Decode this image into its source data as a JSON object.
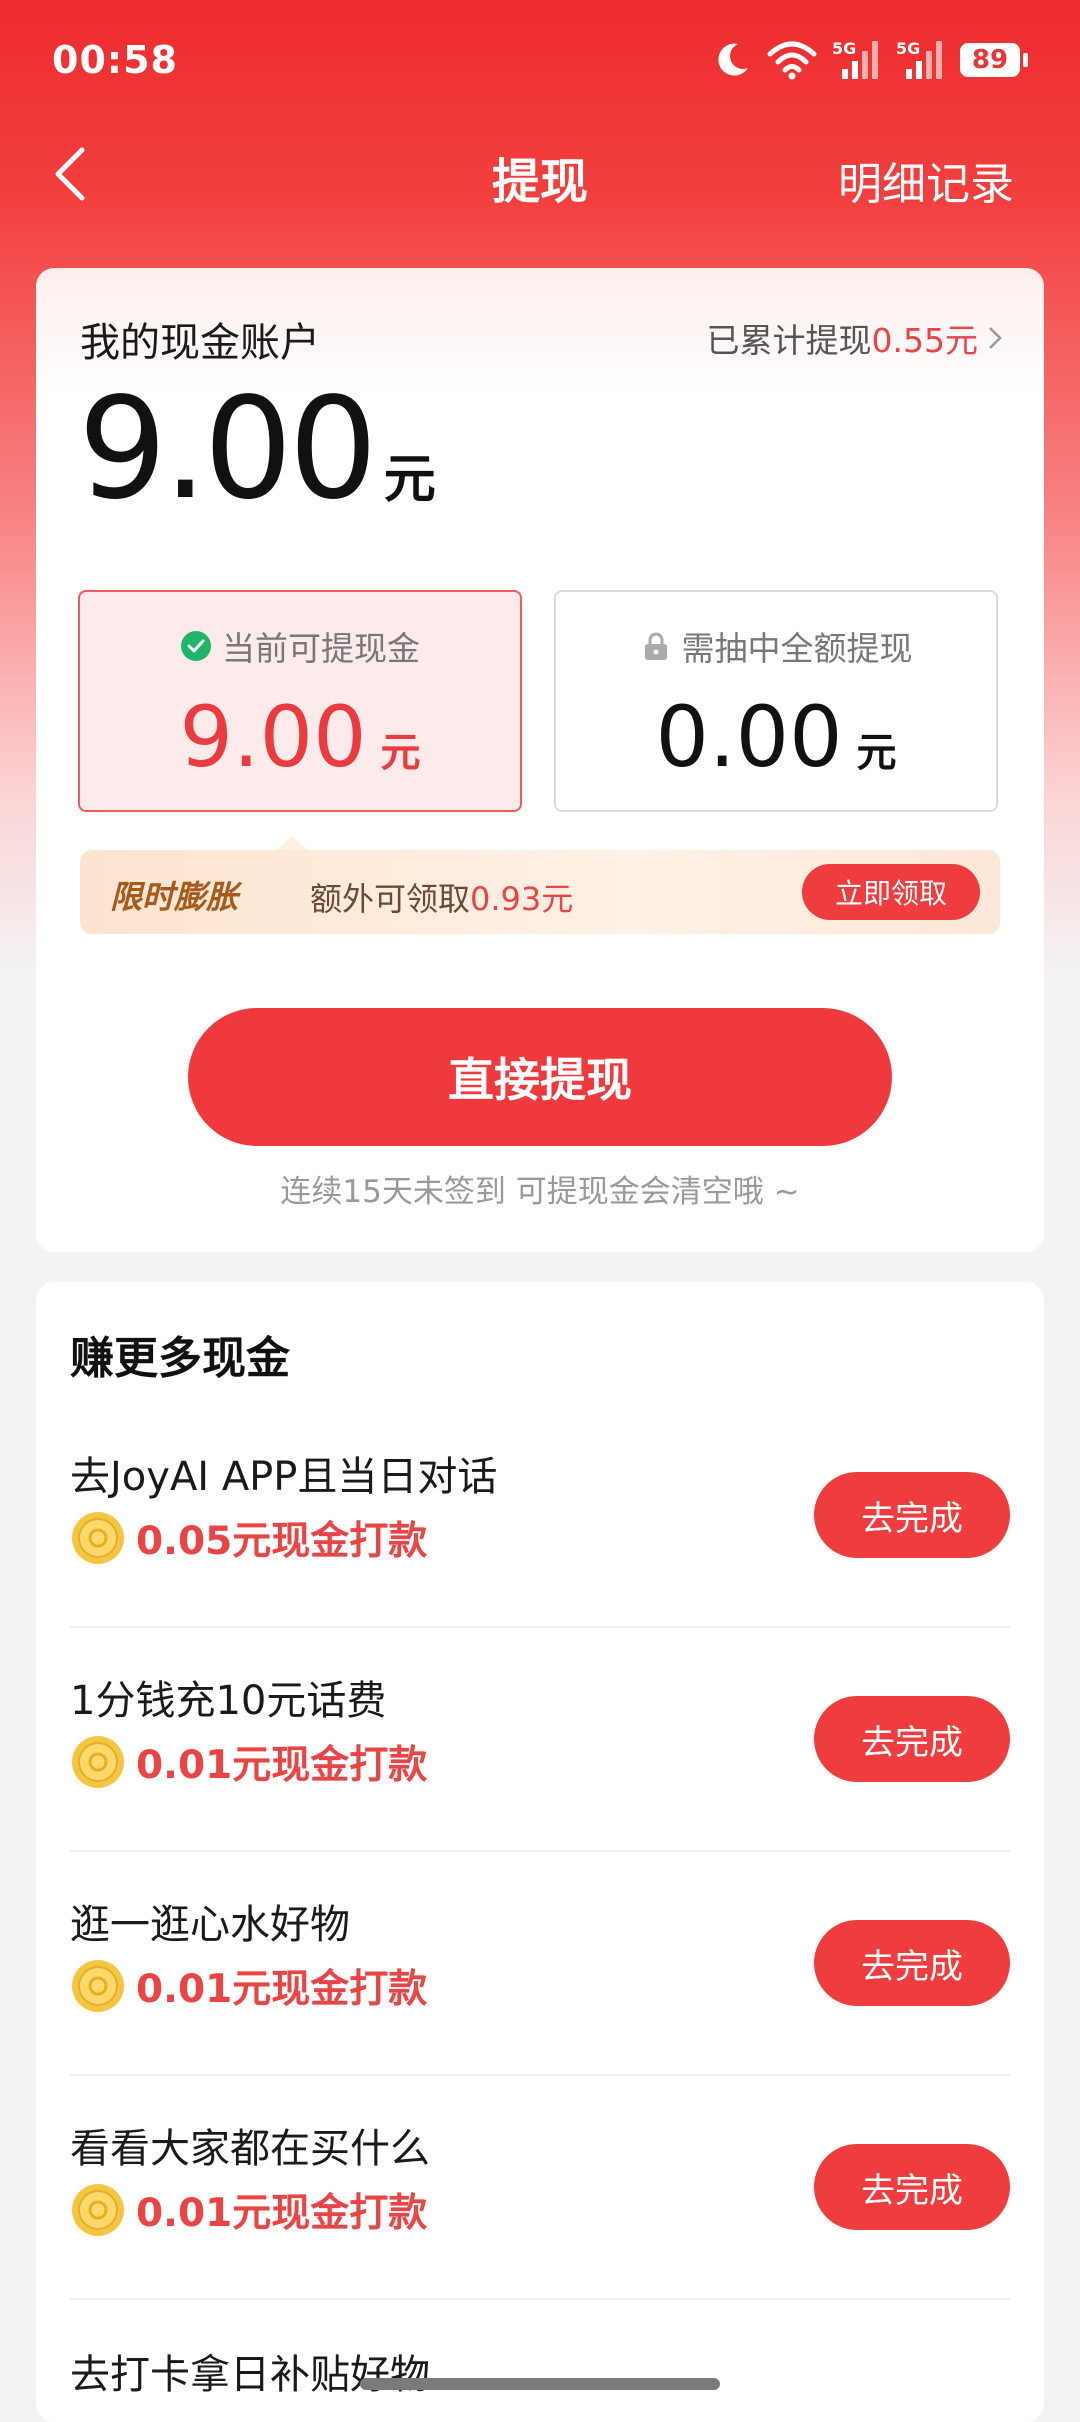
{
  "status_bar": {
    "time": "00:58",
    "network_a": "5G",
    "network_b": "5G",
    "battery": "89"
  },
  "nav": {
    "title": "提现",
    "record": "明细记录"
  },
  "account": {
    "label": "我的现金账户",
    "cum_prefix": "已累计提现",
    "cum_amount": "0.55元",
    "balance": "9.00",
    "balance_unit": "元",
    "available_label": "当前可提现金",
    "available_amount": "9.00",
    "available_unit": "元",
    "locked_label": "需抽中全额提现",
    "locked_amount": "0.00",
    "locked_unit": "元"
  },
  "promo": {
    "tag": "限时膨胀",
    "text_prefix": "额外可领取",
    "amount": "0.93元",
    "button": "立即领取"
  },
  "withdraw": {
    "button": "直接提现",
    "hint": "连续15天未签到 可提现金会清空哦 ~"
  },
  "earn": {
    "title": "赚更多现金",
    "tasks": [
      {
        "name": "去JoyAI APP且当日对话",
        "reward": "0.05元现金打款",
        "button": "去完成"
      },
      {
        "name": "1分钱充10元话费",
        "reward": "0.01元现金打款",
        "button": "去完成"
      },
      {
        "name": "逛一逛心水好物",
        "reward": "0.01元现金打款",
        "button": "去完成"
      },
      {
        "name": "看看大家都在买什么",
        "reward": "0.01元现金打款",
        "button": "去完成"
      }
    ],
    "partial_next": "去打卡拿日补贴好物"
  },
  "colors": {
    "accent": "#ef3c3f",
    "text_red": "#e94446",
    "bg": "#f3f3f5"
  }
}
